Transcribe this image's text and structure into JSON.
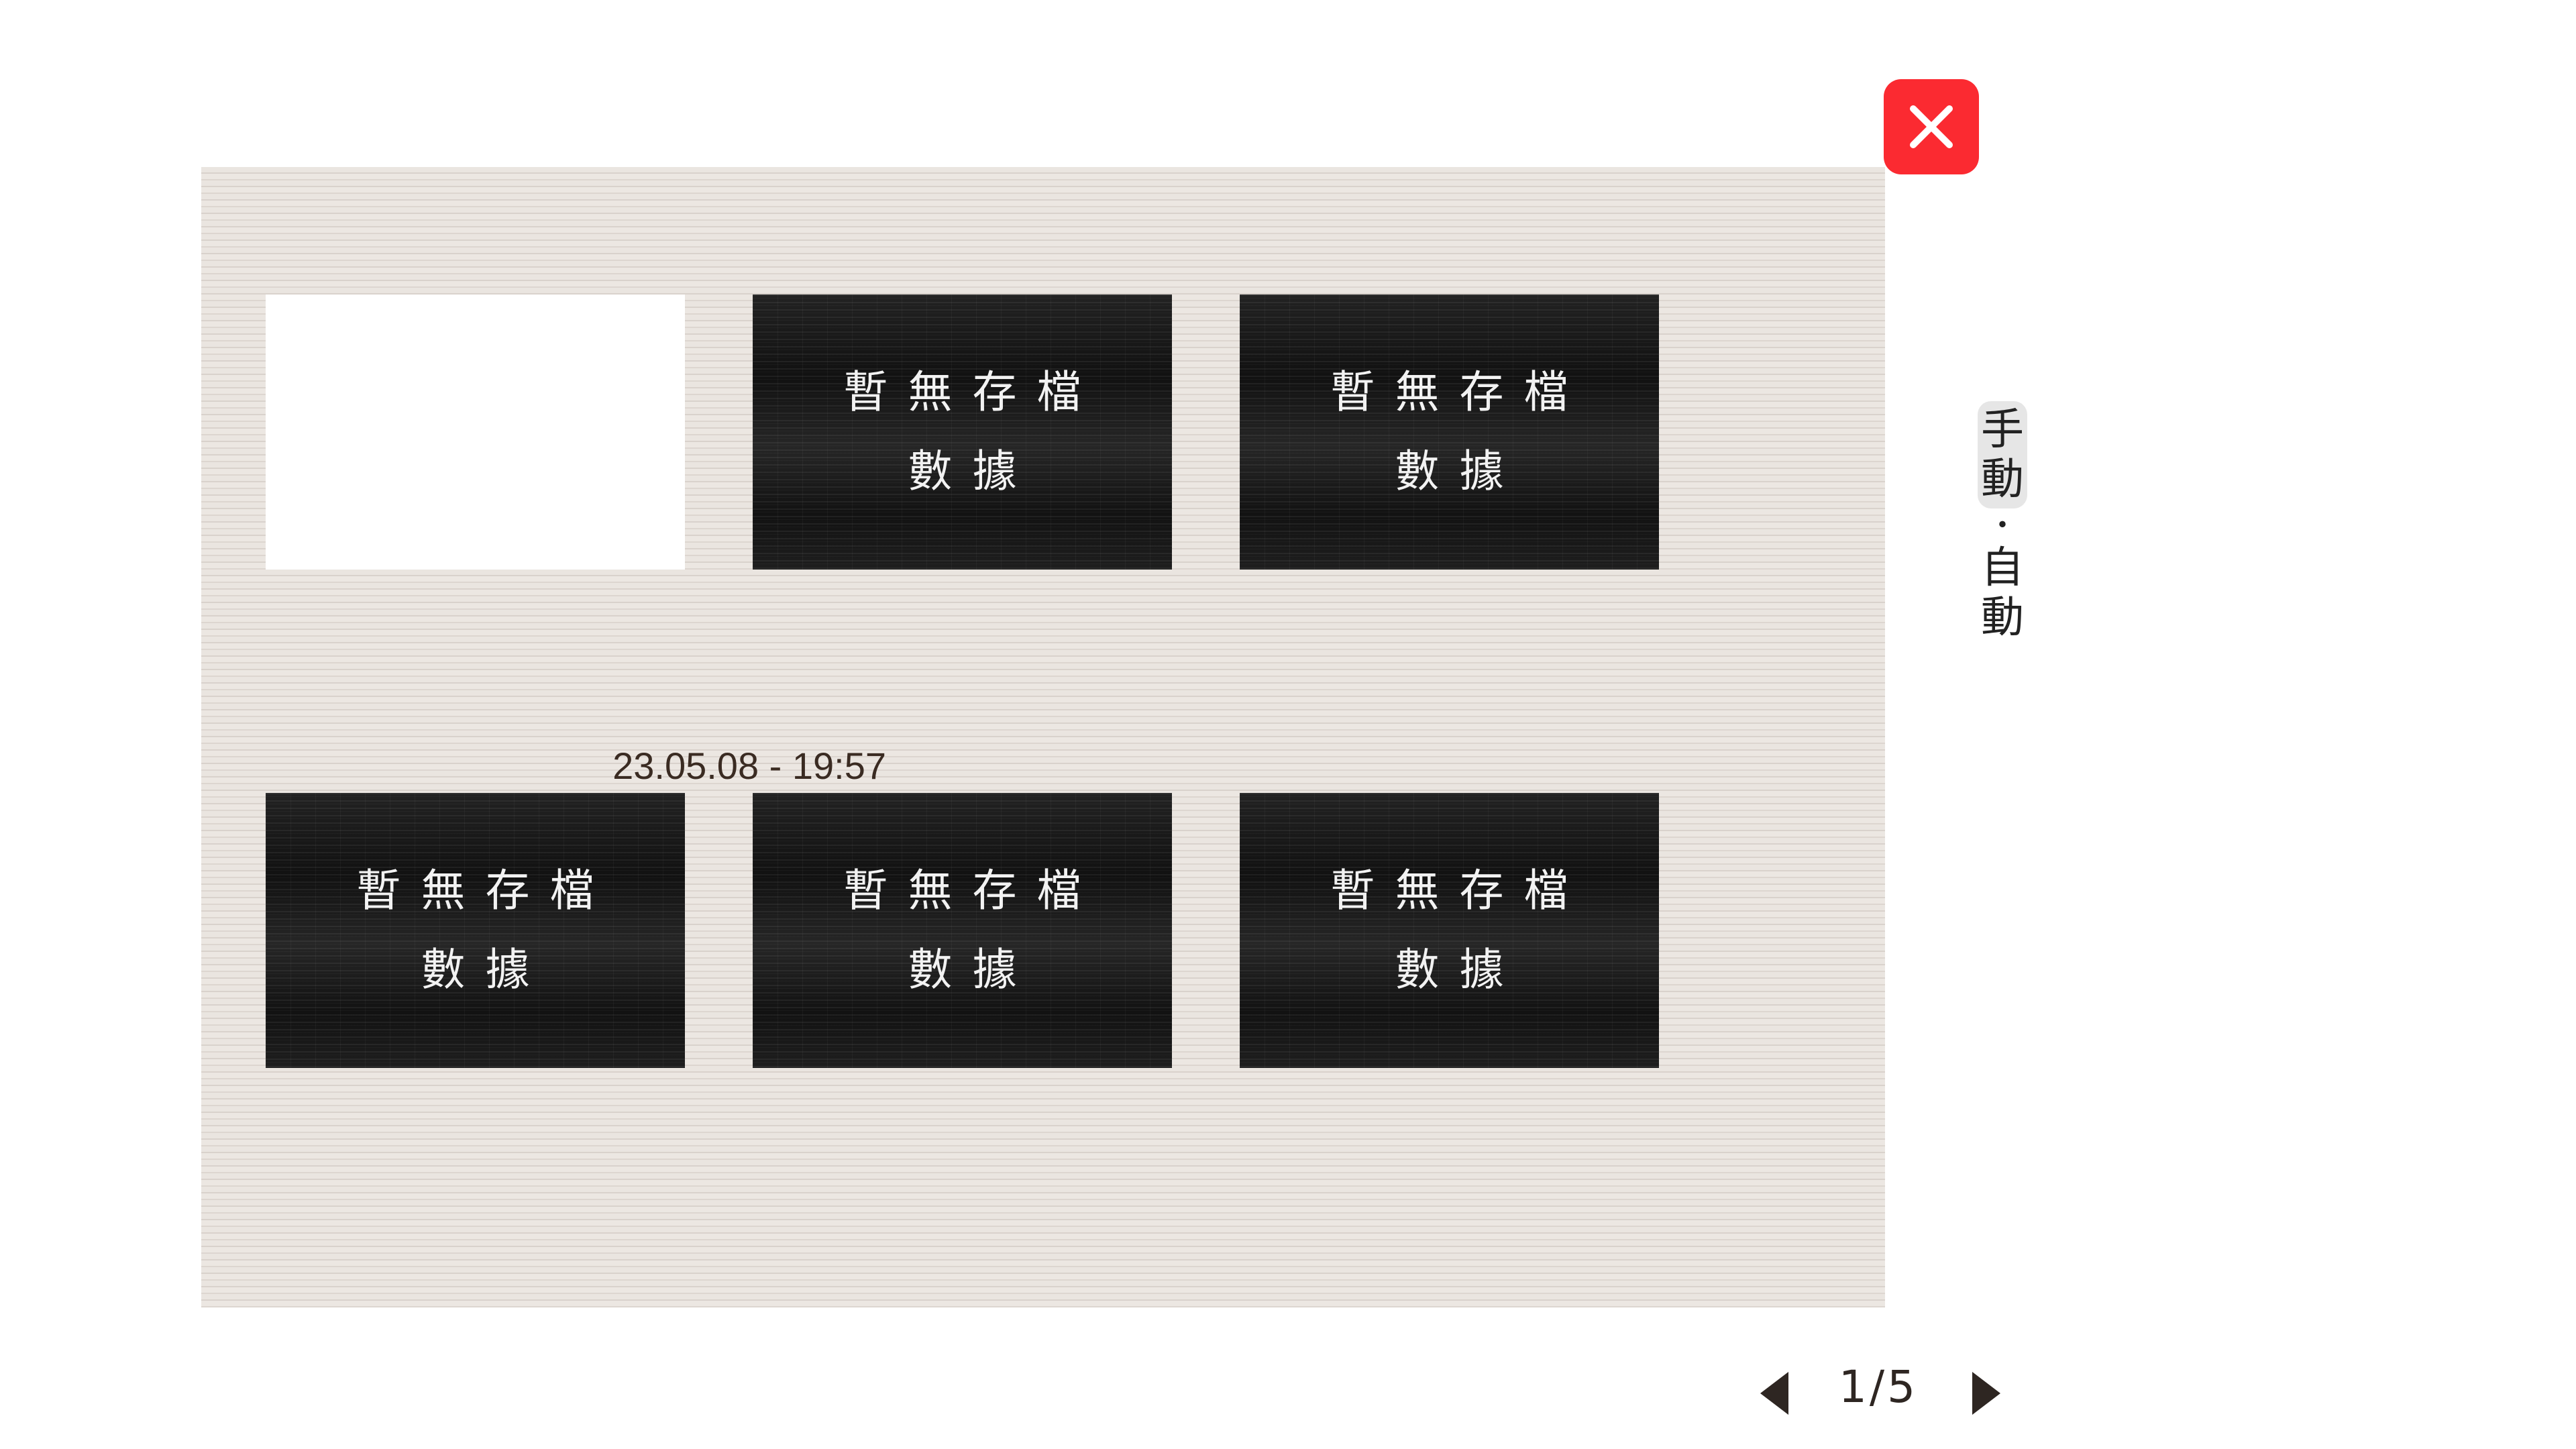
{
  "close_button": {
    "icon": "close-icon",
    "color": "#fb2a31"
  },
  "mode_toggle": {
    "options": [
      {
        "label": "手動",
        "active": true
      },
      {
        "label": "自動",
        "active": false
      }
    ],
    "separator": "・"
  },
  "slots": [
    {
      "state": "filled",
      "timestamp": "23.05.08 - 19:57",
      "line1": "",
      "line2": ""
    },
    {
      "state": "empty",
      "line1": "暫無存檔",
      "line2": "數據"
    },
    {
      "state": "empty",
      "line1": "暫無存檔",
      "line2": "數據"
    },
    {
      "state": "empty",
      "line1": "暫無存檔",
      "line2": "數據"
    },
    {
      "state": "empty",
      "line1": "暫無存檔",
      "line2": "數據"
    },
    {
      "state": "empty",
      "line1": "暫無存檔",
      "line2": "數據"
    }
  ],
  "pagination": {
    "label": "1/5",
    "prev_icon": "caret-left-icon",
    "next_icon": "caret-right-icon"
  }
}
